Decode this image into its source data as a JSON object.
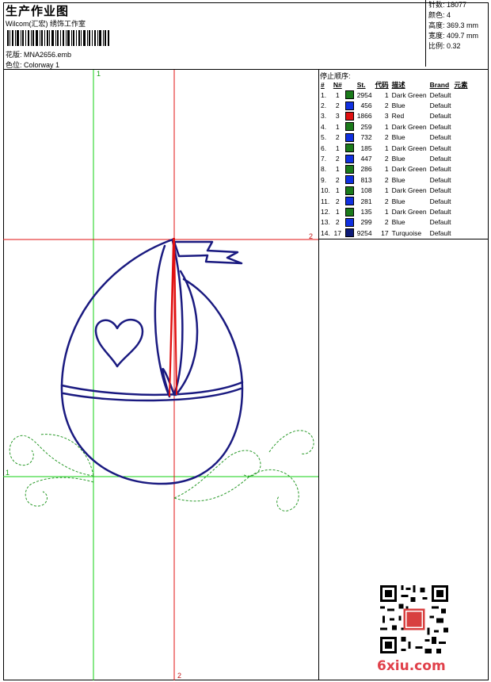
{
  "header": {
    "title": "生产作业图",
    "company": "Wilcom(汇宏) 绣饰工作室",
    "design_file": "花版: MNA2656.emb",
    "colorway": "色位: Colorway 1"
  },
  "stats": {
    "stitches": "针数: 18077",
    "colors": "颜色: 4",
    "height": "高度: 369.3 mm",
    "width": "宽度: 409.7 mm",
    "scale": "比例: 0.32"
  },
  "stop_sequence": {
    "title": "停止顺序:",
    "columns": [
      "#",
      "N#",
      "St.",
      "代码",
      "描述",
      "Brand",
      "元素"
    ],
    "rows": [
      {
        "idx": "1.",
        "n": "1",
        "color": "#1a7a1a",
        "st": "2954",
        "code": "1",
        "desc": "Dark Green",
        "brand": "Default"
      },
      {
        "idx": "2.",
        "n": "2",
        "color": "#1030e0",
        "st": "456",
        "code": "2",
        "desc": "Blue",
        "brand": "Default"
      },
      {
        "idx": "3.",
        "n": "3",
        "color": "#e01010",
        "st": "1866",
        "code": "3",
        "desc": "Red",
        "brand": "Default"
      },
      {
        "idx": "4.",
        "n": "1",
        "color": "#1a7a1a",
        "st": "259",
        "code": "1",
        "desc": "Dark Green",
        "brand": "Default"
      },
      {
        "idx": "5.",
        "n": "2",
        "color": "#1030e0",
        "st": "732",
        "code": "2",
        "desc": "Blue",
        "brand": "Default"
      },
      {
        "idx": "6.",
        "n": "1",
        "color": "#1a7a1a",
        "st": "185",
        "code": "1",
        "desc": "Dark Green",
        "brand": "Default"
      },
      {
        "idx": "7.",
        "n": "2",
        "color": "#1030e0",
        "st": "447",
        "code": "2",
        "desc": "Blue",
        "brand": "Default"
      },
      {
        "idx": "8.",
        "n": "1",
        "color": "#1a7a1a",
        "st": "286",
        "code": "1",
        "desc": "Dark Green",
        "brand": "Default"
      },
      {
        "idx": "9.",
        "n": "2",
        "color": "#1030e0",
        "st": "813",
        "code": "2",
        "desc": "Blue",
        "brand": "Default"
      },
      {
        "idx": "10.",
        "n": "1",
        "color": "#1a7a1a",
        "st": "108",
        "code": "1",
        "desc": "Dark Green",
        "brand": "Default"
      },
      {
        "idx": "11.",
        "n": "2",
        "color": "#1030e0",
        "st": "281",
        "code": "2",
        "desc": "Blue",
        "brand": "Default"
      },
      {
        "idx": "12.",
        "n": "1",
        "color": "#1a7a1a",
        "st": "135",
        "code": "1",
        "desc": "Dark Green",
        "brand": "Default"
      },
      {
        "idx": "13.",
        "n": "2",
        "color": "#1030e0",
        "st": "299",
        "code": "2",
        "desc": "Blue",
        "brand": "Default"
      },
      {
        "idx": "14.",
        "n": "17",
        "color": "#0c1a78",
        "st": "9254",
        "code": "17",
        "desc": "Turquoise",
        "brand": "Default"
      }
    ]
  },
  "guides": {
    "green_top": "1",
    "green_left": "1",
    "red_right": "2",
    "red_bottom": "2"
  },
  "watermark": "6xiu.com",
  "colors": {
    "outline": "#1a1a80",
    "red_guide": "#e01010",
    "green_guide": "#10d010",
    "wave": "#2a9a2a"
  },
  "icons": {
    "barcode": "barcode-icon",
    "qr": "qr-code-icon"
  }
}
